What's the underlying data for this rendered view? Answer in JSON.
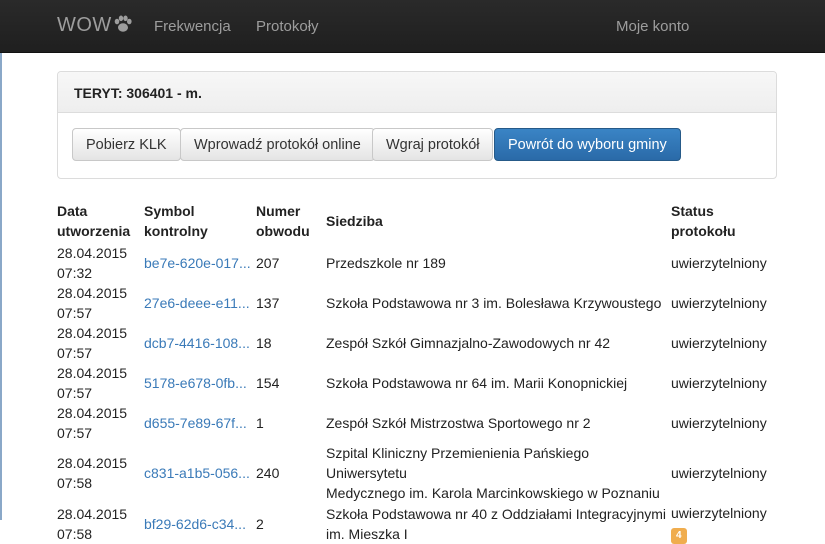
{
  "navbar": {
    "brand": "WOW",
    "links": [
      "Frekwencja",
      "Protokoły"
    ],
    "account": "Moje konto"
  },
  "panel": {
    "title": "TERYT: 306401 - m.",
    "buttons": [
      "Pobierz KLK",
      "Wprowadź protokół online",
      "Wgraj protokół",
      "Powrót do wyboru gminy"
    ]
  },
  "table": {
    "headers": {
      "date": [
        "Data",
        "utworzenia"
      ],
      "symbol": [
        "Symbol",
        "kontrolny"
      ],
      "number": [
        "Numer",
        "obwodu"
      ],
      "seat": "Siedziba",
      "status": [
        "Status",
        "protokołu"
      ]
    },
    "rows": [
      {
        "date": "28.04.2015",
        "time": "07:32",
        "symbol": "be7e-620e-017...",
        "number": "207",
        "seat": [
          "Przedszkole nr 189"
        ],
        "status": "uwierzytelniony"
      },
      {
        "date": "28.04.2015",
        "time": "07:57",
        "symbol": "27e6-deee-e11...",
        "number": "137",
        "seat": [
          "Szkoła Podstawowa nr 3 im. Bolesława Krzywoustego"
        ],
        "status": "uwierzytelniony"
      },
      {
        "date": "28.04.2015",
        "time": "07:57",
        "symbol": "dcb7-4416-108...",
        "number": "18",
        "seat": [
          "Zespół Szkół Gimnazjalno-Zawodowych nr 42"
        ],
        "status": "uwierzytelniony"
      },
      {
        "date": "28.04.2015",
        "time": "07:57",
        "symbol": "5178-e678-0fb...",
        "number": "154",
        "seat": [
          "Szkoła Podstawowa nr 64 im. Marii Konopnickiej"
        ],
        "status": "uwierzytelniony"
      },
      {
        "date": "28.04.2015",
        "time": "07:57",
        "symbol": "d655-7e89-67f...",
        "number": "1",
        "seat": [
          "Zespół Szkół Mistrzostwa Sportowego nr 2"
        ],
        "status": "uwierzytelniony"
      },
      {
        "date": "28.04.2015",
        "time": "07:58",
        "symbol": "c831-a1b5-056...",
        "number": "240",
        "seat": [
          "Szpital Kliniczny Przemienienia Pańskiego Uniwersytetu",
          "Medycznego im. Karola Marcinkowskiego w Poznaniu"
        ],
        "status": "uwierzytelniony"
      },
      {
        "date": "28.04.2015",
        "time": "07:58",
        "symbol": "bf29-62d6-c34...",
        "number": "2",
        "seat": [
          "Szkoła Podstawowa nr 40 z Oddziałami Integracyjnymi",
          "im. Mieszka I"
        ],
        "status": "uwierzytelniony",
        "badge": "4"
      }
    ]
  },
  "colors": {
    "navbar": "#222222",
    "link": "#3a7ab8",
    "primary_button": "#337ab7",
    "badge": "#f0ad4e"
  }
}
